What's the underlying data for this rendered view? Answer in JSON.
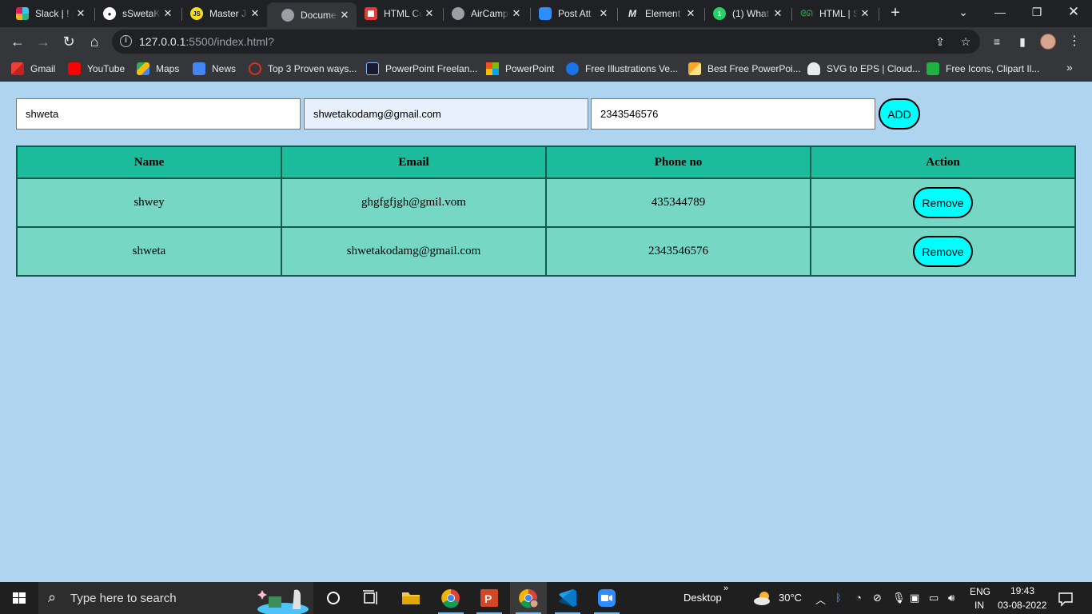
{
  "browser": {
    "tabs": [
      {
        "title": "Slack | ! | ",
        "icon": "slack-icon"
      },
      {
        "title": "sSwetaK",
        "icon": "github-icon"
      },
      {
        "title": "Master J",
        "icon": "js-icon"
      },
      {
        "title": "Docume",
        "icon": "globe-icon",
        "active": true
      },
      {
        "title": "HTML Co",
        "icon": "record-icon"
      },
      {
        "title": "AirCamp",
        "icon": "globe-icon"
      },
      {
        "title": "Post Att",
        "icon": "zoom-icon"
      },
      {
        "title": "Element",
        "icon": "medium-icon"
      },
      {
        "title": "(1) What",
        "icon": "whatsapp-icon"
      },
      {
        "title": "HTML | S",
        "icon": "gfg-icon"
      }
    ],
    "url_host": "127.0.0.1",
    "url_rest": ":5500/index.html?",
    "bookmarks": [
      {
        "label": "Gmail",
        "icon": "gmail-icon"
      },
      {
        "label": "YouTube",
        "icon": "youtube-icon"
      },
      {
        "label": "Maps",
        "icon": "maps-icon"
      },
      {
        "label": "News",
        "icon": "news-icon"
      },
      {
        "label": "Top 3 Proven ways...",
        "icon": "wp-icon"
      },
      {
        "label": "PowerPoint Freelan...",
        "icon": "freelance-icon"
      },
      {
        "label": "PowerPoint",
        "icon": "microsoft-icon"
      },
      {
        "label": "Free Illustrations Ve...",
        "icon": "illustration-icon"
      },
      {
        "label": "Best Free PowerPoi...",
        "icon": "ppt-icon"
      },
      {
        "label": "SVG to EPS | Cloud...",
        "icon": "cloud-icon"
      },
      {
        "label": "Free Icons, Clipart Il...",
        "icon": "icons8-icon"
      }
    ]
  },
  "form": {
    "name_value": "shweta",
    "email_value": "shwetakodamg@gmail.com",
    "phone_value": "2343546576",
    "add_label": "ADD"
  },
  "table": {
    "headers": [
      "Name",
      "Email",
      "Phone no",
      "Action"
    ],
    "rows": [
      {
        "name": "shwey",
        "email": "ghgfgfjgh@gmil.vom",
        "phone": "435344789",
        "action": "Remove"
      },
      {
        "name": "shweta",
        "email": "shwetakodamg@gmail.com",
        "phone": "2343546576",
        "action": "Remove"
      }
    ]
  },
  "taskbar": {
    "search_placeholder": "Type here to search",
    "desktop_label": "Desktop",
    "temperature": "30°C",
    "lang_line1": "ENG",
    "lang_line2": "IN",
    "time": "19:43",
    "date": "03-08-2022"
  },
  "colors": {
    "page_bg": "#aed4ef",
    "header_bg": "#1abc9c",
    "cell_bg": "#76d7c4",
    "button_bg": "#00ffff"
  }
}
